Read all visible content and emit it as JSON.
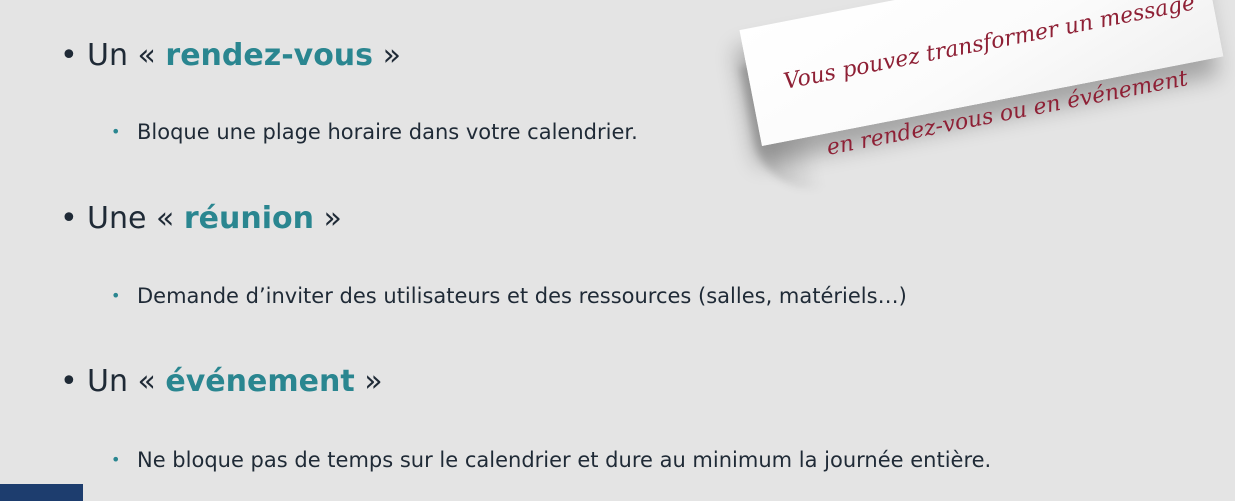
{
  "items": [
    {
      "prefix": "Un « ",
      "keyword": "rendez-vous",
      "suffix": " »",
      "detail": "Bloque une plage horaire dans votre calendrier."
    },
    {
      "prefix": "Une « ",
      "keyword": "réunion",
      "suffix": " »",
      "detail": "Demande d’inviter des utilisateurs et des ressources (salles, matériels…)"
    },
    {
      "prefix": "Un « ",
      "keyword": "événement",
      "suffix": " »",
      "detail": "Ne bloque pas de temps sur le calendrier et dure au minimum la journée entière."
    }
  ],
  "note": {
    "line1": "Vous pouvez transformer un message",
    "line2": "en rendez-vous ou en événement"
  },
  "bullet_level1": "•",
  "bullet_level2": "•",
  "colors": {
    "background": "#e4e4e4",
    "text": "#1f2a36",
    "keyword": "#2a8690",
    "note_text": "#8e2035",
    "corner_mark": "#1d3d6e"
  }
}
